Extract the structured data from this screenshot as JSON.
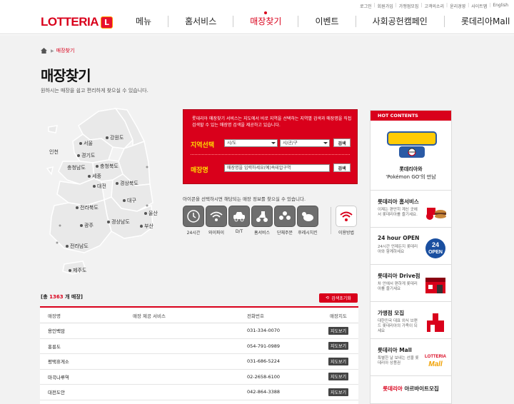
{
  "util_links": [
    "로그인",
    "회원가입",
    "가맹점모집",
    "고객의소리",
    "윤리경영",
    "사이트맵",
    "English"
  ],
  "logo": {
    "text": "LOTTERIA",
    "mark": "L"
  },
  "gnb": [
    "메뉴",
    "홈서비스",
    "매장찾기",
    "이벤트",
    "사회공헌캠페인",
    "롯데리아Mall"
  ],
  "breadcrumb": {
    "current": "매장찾기"
  },
  "page": {
    "title": "매장찾기",
    "desc": "원하시는 매장을 쉽고 편리하게 찾으실 수 있습니다."
  },
  "map_regions": [
    "강원도",
    "인천",
    "서울",
    "경기도",
    "충청남도",
    "충청북도",
    "세종",
    "대전",
    "경상북도",
    "전라북도",
    "대구",
    "울산",
    "광주",
    "경상남도",
    "부산",
    "전라남도",
    "제주도"
  ],
  "search": {
    "desc": "롯데리아 매장찾기 서비스는 지도에서 바로 지역을 선택하는 지역별 검색과 매장명을 직접 검색할 수 있는 매장명 검색을 제공하고 있습니다.",
    "region_label": "지역선택",
    "sido": "시/도",
    "gugun": "시/군/구",
    "search_btn": "검색",
    "name_label": "매장명",
    "name_placeholder": "매장명을 입력하세요(예)속테압구역",
    "search_btn2": "검색"
  },
  "filters": {
    "desc": "아이콘을 선택하시면 해당되는 매장 정보를 찾으실 수 있습니다.",
    "items": [
      "24시간",
      "와이파이",
      "D/T",
      "홈서비스",
      "단체주문",
      "후레시치킨"
    ],
    "useinfo": "이용방법"
  },
  "results": {
    "prefix": "[총",
    "count": "1363",
    "suffix": "개 매장]",
    "keyword_btn": "검색초기화"
  },
  "table": {
    "headers": [
      "매장명",
      "매장 제공 서비스",
      "전화번호",
      "매장지도"
    ],
    "rows": [
      {
        "name": "용인백암",
        "phone": "031-334-0070",
        "map": "지도보기"
      },
      {
        "name": "홍릉도",
        "phone": "054-791-0989",
        "map": "지도보기"
      },
      {
        "name": "평택휴게소",
        "phone": "031-686-5224",
        "map": "지도보기"
      },
      {
        "name": "마곡나루역",
        "phone": "02-2658-6100",
        "map": "지도보기"
      },
      {
        "name": "대전도안",
        "phone": "042-864-3388",
        "map": "지도보기"
      }
    ]
  },
  "hot": {
    "header": "HOT CONTENTS",
    "pokemon": {
      "line1": "롯데리아와",
      "line2": "'Pokémon GO'의 만남"
    },
    "items": [
      {
        "title": "롯데리아 홈서비스",
        "desc": "이제는 편안히 계신 곳에서 롯데리아를 즐기세요."
      },
      {
        "title": "24 hour OPEN",
        "desc": "24시간 언제든지 롯데리아와 함께하세요"
      },
      {
        "title": "롯데리아 Drive점",
        "desc": "차 안에서 편하게 롯데리아를 즐기세요"
      },
      {
        "title": "가맹점 모집",
        "desc": "대한민국 대표 외식 브랜드 롯데리아의 가족이 되세요"
      },
      {
        "title": "롯데리아 Mall",
        "desc": "특별한 날 보내는 선물 롯데리아 상품권"
      }
    ],
    "bottom_brand": "롯데리아",
    "bottom_text": "아르바이트모집"
  },
  "colors": {
    "brand_red": "#d9001b",
    "highlight_yellow": "#ffde00",
    "filter_gray": "#6e6e6e"
  }
}
